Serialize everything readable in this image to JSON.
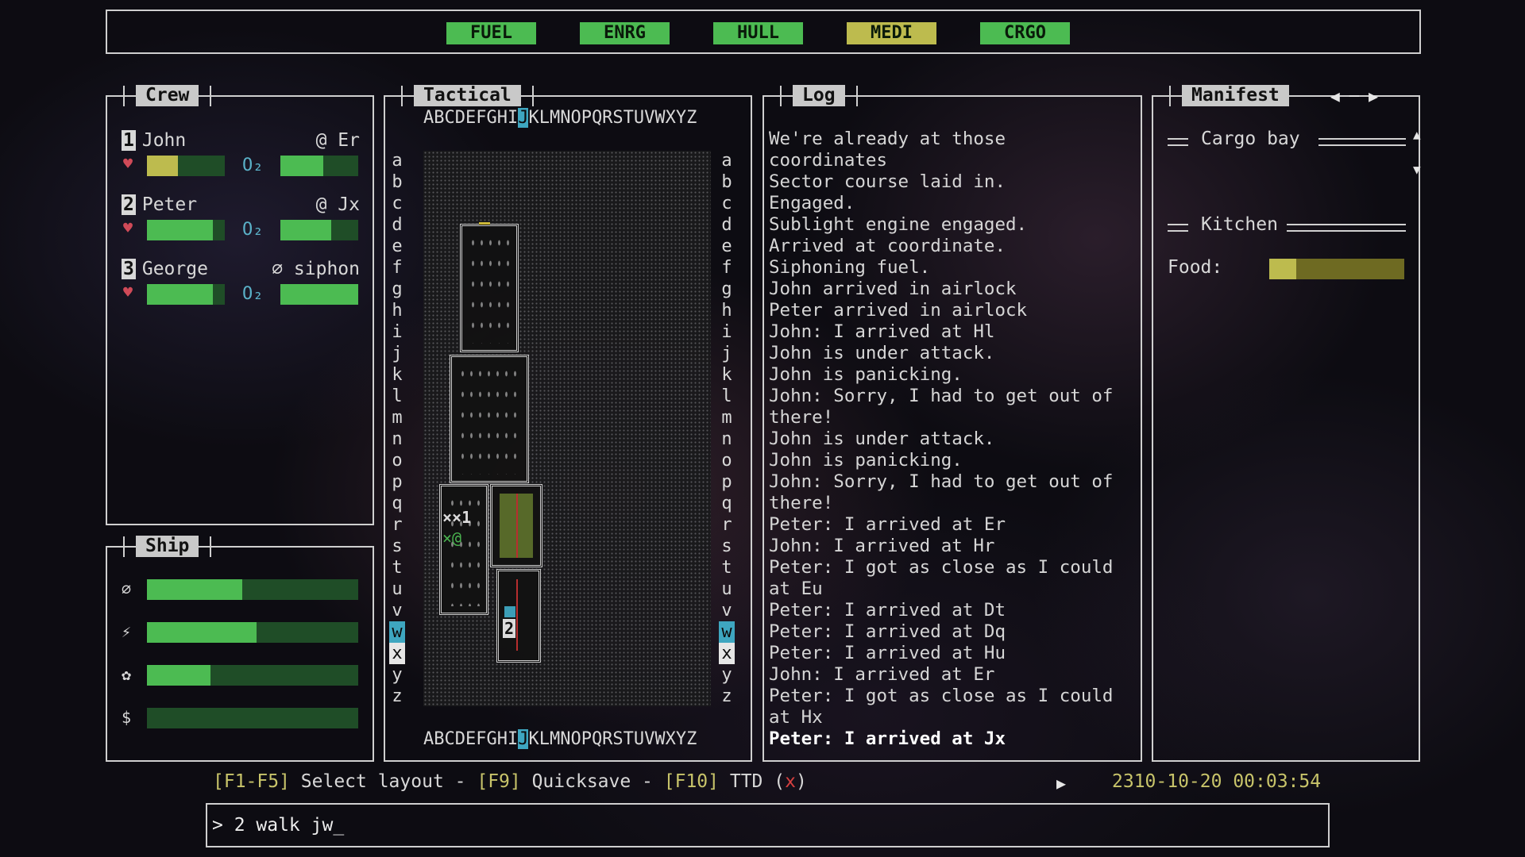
{
  "topbar": {
    "gauges": [
      {
        "label": "FUEL",
        "color": "#4cbb52"
      },
      {
        "label": "ENRG",
        "color": "#4cbb52"
      },
      {
        "label": "HULL",
        "color": "#4cbb52"
      },
      {
        "label": "MEDI",
        "color": "#bdbb4e"
      },
      {
        "label": "CRGO",
        "color": "#4cbb52"
      }
    ]
  },
  "crew": {
    "title": "Crew",
    "members": [
      {
        "num": "1",
        "name": "John",
        "location": "@ Er",
        "health": 0.4,
        "o2": 0.55,
        "health_color": "#bdbb4e"
      },
      {
        "num": "2",
        "name": "Peter",
        "location": "@ Jx",
        "health": 0.85,
        "o2": 0.65,
        "health_color": "#4cbb52"
      },
      {
        "num": "3",
        "name": "George",
        "location": "⌀ siphon",
        "health": 0.85,
        "o2": 1.0,
        "health_color": "#4cbb52"
      }
    ],
    "o2_label": "O₂",
    "heart": "♥"
  },
  "ship": {
    "title": "Ship",
    "stats": [
      {
        "icon": "⌀",
        "value": 0.45
      },
      {
        "icon": "⚡",
        "value": 0.52
      },
      {
        "icon": "✿",
        "value": 0.3
      },
      {
        "icon": "$",
        "value": 0.0
      }
    ]
  },
  "tactical": {
    "title": "Tactical",
    "cols_before": "ABCDEFGHI",
    "col_highlight": "J",
    "cols_after": "KLMNOPQRSTUVWXYZ",
    "rows": [
      "a",
      "b",
      "c",
      "d",
      "e",
      "f",
      "g",
      "h",
      "i",
      "j",
      "k",
      "l",
      "m",
      "n",
      "o",
      "p",
      "q",
      "r",
      "s",
      "t",
      "u",
      "v",
      "w",
      "x",
      "y",
      "z"
    ],
    "row_highlight": "w",
    "row_highlight2": "x",
    "marker_1": "××1",
    "marker_at": "×@",
    "marker_2": "2"
  },
  "log": {
    "title": "Log",
    "lines": [
      "We're already at those",
      "coordinates",
      "Sector course laid in.",
      "Engaged.",
      "Sublight engine engaged.",
      "Arrived at coordinate.",
      "Siphoning fuel.",
      "John arrived in airlock",
      "Peter arrived in airlock",
      "John: I arrived at Hl",
      "John is under attack.",
      "John is panicking.",
      "John: Sorry, I had to get out of",
      "there!",
      "John is under attack.",
      "John is panicking.",
      "John: Sorry, I had to get out of",
      "there!",
      "Peter: I arrived at Er",
      "John: I arrived at Hr",
      "Peter: I got as close as I could",
      "at Eu",
      "Peter: I arrived at Dt",
      "Peter: I arrived at Dq",
      "Peter: I arrived at Hu",
      "John: I arrived at Er",
      "Peter: I got as close as I could",
      "at Hx",
      "Peter: I arrived at Jx"
    ]
  },
  "manifest": {
    "title": "Manifest",
    "nav": "◀ ─ ▶",
    "sections": [
      {
        "label": "Cargo bay"
      },
      {
        "label": "Kitchen"
      }
    ],
    "food_label": "Food:",
    "food_value": 0.2
  },
  "hint": {
    "k1": "[F1-F5]",
    "t1": " Select layout - ",
    "k2": "[F9]",
    "t2": " Quicksave - ",
    "k3": "[F10]",
    "t3": " TTD (",
    "x": "x",
    "t4": ")"
  },
  "clock": "2310-10-20 00:03:54",
  "play": "▶",
  "command": "> 2 walk jw_"
}
